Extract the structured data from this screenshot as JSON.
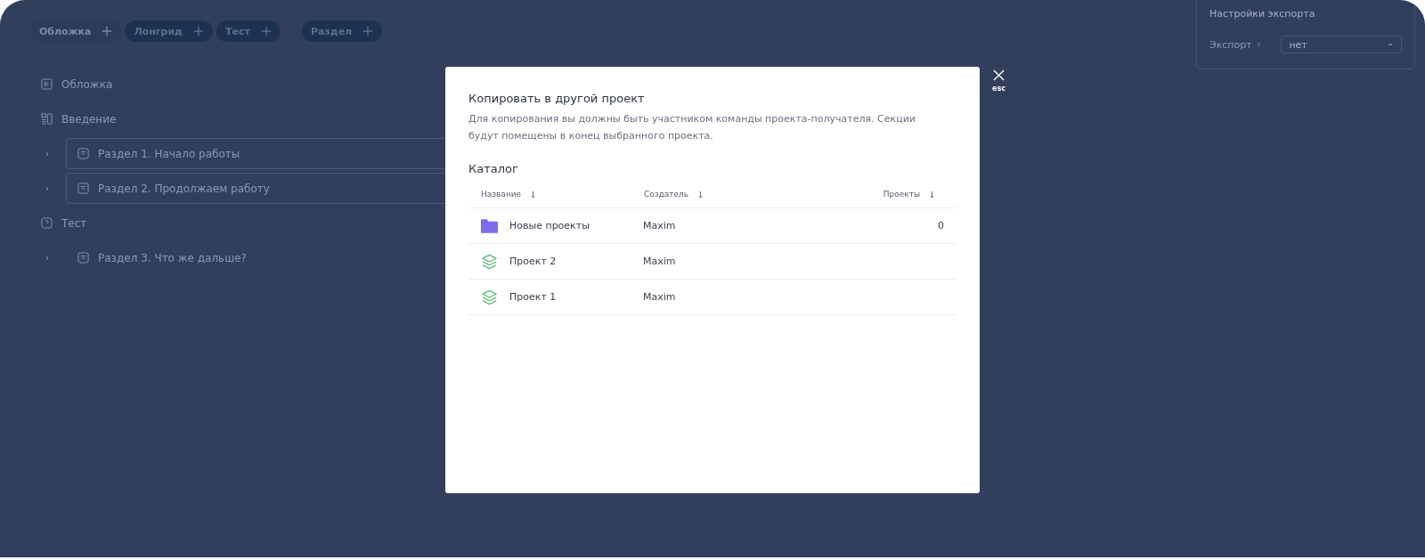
{
  "block_buttons": [
    {
      "label": "Обложка",
      "disabled": true
    },
    {
      "label": "Лонгрид",
      "disabled": false
    },
    {
      "label": "Тест",
      "disabled": false
    }
  ],
  "section_button": {
    "label": "Раздел"
  },
  "tree": [
    {
      "kind": "cover",
      "label": "Обложка"
    },
    {
      "kind": "longread",
      "label": "Введение",
      "children": [
        {
          "label": "Раздел 1. Начало работы",
          "framed": true
        },
        {
          "label": "Раздел 2. Продолжаем работу",
          "framed": true
        }
      ]
    },
    {
      "kind": "test",
      "label": "Тест",
      "children": [
        {
          "label": "Раздел 3. Что же дальше?",
          "framed": false
        }
      ]
    }
  ],
  "export_panel": {
    "title": "Настройки экспорта",
    "label": "Экспорт",
    "value": "нет"
  },
  "dialog": {
    "title": "Копировать в другой проект",
    "description": "Для копирования вы должны быть участником команды проекта-получателя. Секции будут помещены в конец выбранного проекта.",
    "catalog_title": "Каталог",
    "close_hint": "esc",
    "columns": [
      "Название",
      "Создатель",
      "Проекты"
    ],
    "rows": [
      {
        "kind": "folder",
        "name": "Новые проекты",
        "creator": "Maxim",
        "projects": "0"
      },
      {
        "kind": "project",
        "name": "Проект 2",
        "creator": "Maxim"
      },
      {
        "kind": "project",
        "name": "Проект 1",
        "creator": "Maxim"
      }
    ]
  }
}
